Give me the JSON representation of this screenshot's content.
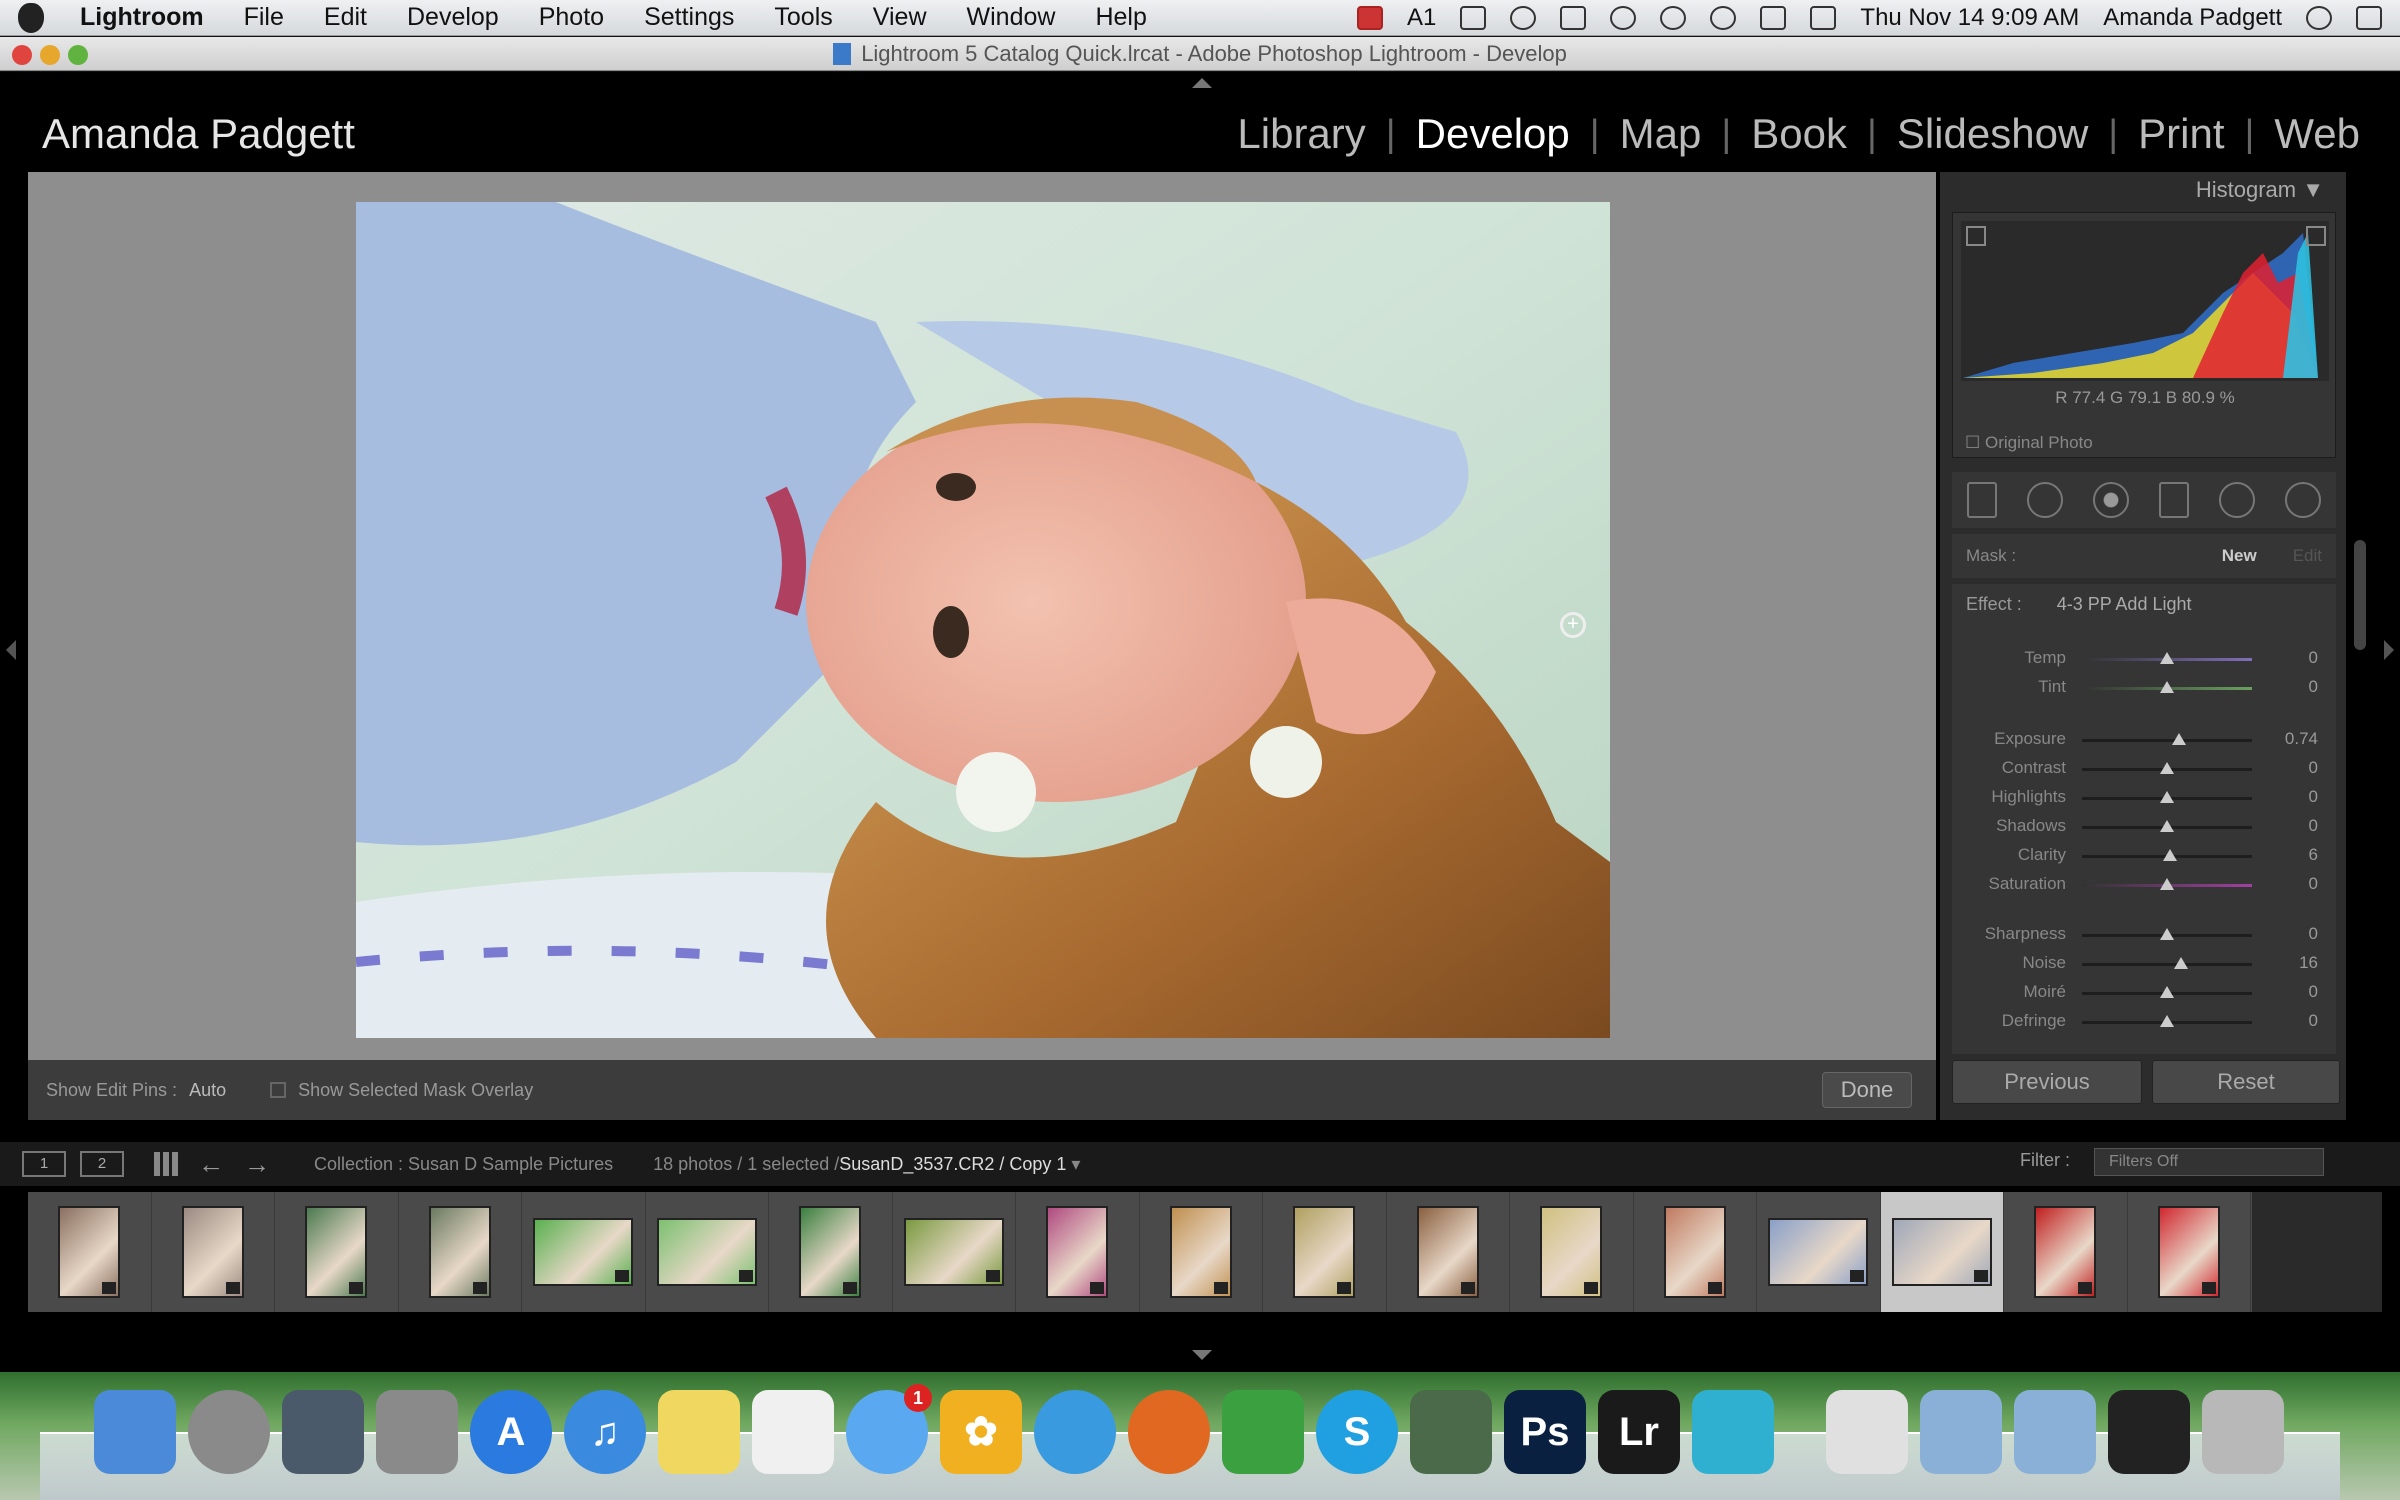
{
  "menubar": {
    "app": "Lightroom",
    "items": [
      "File",
      "Edit",
      "Develop",
      "Photo",
      "Settings",
      "Tools",
      "View",
      "Window",
      "Help"
    ],
    "status_badge": "1",
    "clock": "Thu Nov 14  9:09 AM",
    "user": "Amanda Padgett"
  },
  "window": {
    "title": "Lightroom 5 Catalog Quick.lrcat - Adobe Photoshop Lightroom - Develop"
  },
  "identity_plate": "Amanda Padgett",
  "modules": [
    "Library",
    "Develop",
    "Map",
    "Book",
    "Slideshow",
    "Print",
    "Web"
  ],
  "active_module": "Develop",
  "toolbar": {
    "edit_pins_label": "Show Edit Pins :",
    "edit_pins_value": "Auto",
    "mask_overlay_label": "Show Selected Mask Overlay",
    "done": "Done"
  },
  "histogram": {
    "title": "Histogram",
    "rgb": "R  77.4   G  79.1   B  80.9 %",
    "original_photo": "Original Photo"
  },
  "mask": {
    "label": "Mask :",
    "new": "New",
    "edit": "Edit"
  },
  "effect": {
    "label": "Effect :",
    "value": "4-3 PP Add Light"
  },
  "sliders": [
    {
      "label": "Temp",
      "value": "0",
      "pos": 0.5,
      "color": "#7f6fb8"
    },
    {
      "label": "Tint",
      "value": "0",
      "pos": 0.5,
      "color": "#6aa060"
    },
    {
      "label": "Exposure",
      "value": "0.74",
      "pos": 0.57
    },
    {
      "label": "Contrast",
      "value": "0",
      "pos": 0.5
    },
    {
      "label": "Highlights",
      "value": "0",
      "pos": 0.5
    },
    {
      "label": "Shadows",
      "value": "0",
      "pos": 0.5
    },
    {
      "label": "Clarity",
      "value": "6",
      "pos": 0.52
    },
    {
      "label": "Saturation",
      "value": "0",
      "pos": 0.5,
      "color": "#a040a0"
    },
    {
      "label": "Sharpness",
      "value": "0",
      "pos": 0.5
    },
    {
      "label": "Noise",
      "value": "16",
      "pos": 0.58
    },
    {
      "label": "Moiré",
      "value": "0",
      "pos": 0.5
    },
    {
      "label": "Defringe",
      "value": "0",
      "pos": 0.5
    }
  ],
  "panel_buttons": {
    "previous": "Previous",
    "reset": "Reset"
  },
  "filmstrip_bar": {
    "page1": "1",
    "page2": "2",
    "collection": "Collection : Susan D Sample Pictures",
    "count": "18 photos / 1 selected /",
    "file": "SusanD_3537.CR2 / Copy 1",
    "filter_label": "Filter :",
    "filter_value": "Filters Off"
  },
  "filmstrip": [
    {
      "orient": "portrait",
      "bg": "#8a7060",
      "selected": false
    },
    {
      "orient": "portrait",
      "bg": "#9a8a80",
      "selected": false
    },
    {
      "orient": "portrait",
      "bg": "#4c7a50",
      "selected": false
    },
    {
      "orient": "portrait",
      "bg": "#6a7a60",
      "selected": false
    },
    {
      "orient": "landscape",
      "bg": "#5ab050",
      "selected": false
    },
    {
      "orient": "landscape",
      "bg": "#7cc070",
      "selected": false
    },
    {
      "orient": "portrait",
      "bg": "#3a8040",
      "selected": false
    },
    {
      "orient": "landscape",
      "bg": "#7a9a40",
      "selected": false
    },
    {
      "orient": "portrait",
      "bg": "#b04a80",
      "selected": false
    },
    {
      "orient": "portrait",
      "bg": "#c09050",
      "selected": false
    },
    {
      "orient": "portrait",
      "bg": "#b0a060",
      "selected": false
    },
    {
      "orient": "portrait",
      "bg": "#8a6040",
      "selected": false
    },
    {
      "orient": "portrait",
      "bg": "#d0c080",
      "selected": false
    },
    {
      "orient": "portrait",
      "bg": "#c07a60",
      "selected": false
    },
    {
      "orient": "landscape",
      "bg": "#8aa0c8",
      "selected": false
    },
    {
      "orient": "landscape",
      "bg": "#a0a8b8",
      "selected": true
    },
    {
      "orient": "portrait",
      "bg": "#c02020",
      "selected": false
    },
    {
      "orient": "portrait",
      "bg": "#d02830",
      "selected": false
    }
  ],
  "dock": [
    {
      "name": "finder-icon",
      "bg": "#4a8ad8",
      "label": "",
      "round": false
    },
    {
      "name": "launchpad-icon",
      "bg": "#8a8a8a",
      "label": "",
      "round": true
    },
    {
      "name": "mission-control-icon",
      "bg": "#4a5a6a",
      "label": "",
      "round": false
    },
    {
      "name": "system-preferences-icon",
      "bg": "#8a8a8a",
      "label": "",
      "round": false
    },
    {
      "name": "app-store-icon",
      "bg": "#2a7ae0",
      "label": "A",
      "round": true
    },
    {
      "name": "itunes-icon",
      "bg": "#3a8ae0",
      "label": "♫",
      "round": true
    },
    {
      "name": "stickies-icon",
      "bg": "#f0d860",
      "label": "",
      "round": false
    },
    {
      "name": "reminders-icon",
      "bg": "#f0f0f0",
      "label": "",
      "round": false
    },
    {
      "name": "messages-icon",
      "bg": "#5aa8f0",
      "label": "",
      "round": true,
      "badge": true
    },
    {
      "name": "iphoto-icon",
      "bg": "#f0b020",
      "label": "✿",
      "round": false
    },
    {
      "name": "safari-icon",
      "bg": "#3a9ae0",
      "label": "",
      "round": true
    },
    {
      "name": "firefox-icon",
      "bg": "#e06820",
      "label": "",
      "round": true
    },
    {
      "name": "evernote-icon",
      "bg": "#3aa040",
      "label": "",
      "round": false
    },
    {
      "name": "skype-icon",
      "bg": "#20a0e0",
      "label": "S",
      "round": true
    },
    {
      "name": "xquartz-icon",
      "bg": "#4a6a4a",
      "label": "",
      "round": false
    },
    {
      "name": "photoshop-icon",
      "bg": "#0a2040",
      "label": "Ps",
      "round": false
    },
    {
      "name": "lightroom-icon",
      "bg": "#1a1a1a",
      "label": "Lr",
      "round": false
    },
    {
      "name": "capture-icon",
      "bg": "#30b0d0",
      "label": "",
      "round": false
    },
    {
      "name": "preview-icon",
      "bg": "#e0e0e0",
      "label": "",
      "round": false
    },
    {
      "name": "applications-folder-icon",
      "bg": "#8ab0d8",
      "label": "",
      "round": false
    },
    {
      "name": "documents-folder-icon",
      "bg": "#8ab0d8",
      "label": "",
      "round": false
    },
    {
      "name": "display-icon",
      "bg": "#222222",
      "label": "",
      "round": false
    },
    {
      "name": "trash-icon",
      "bg": "#b8b8b8",
      "label": "",
      "round": false
    }
  ]
}
